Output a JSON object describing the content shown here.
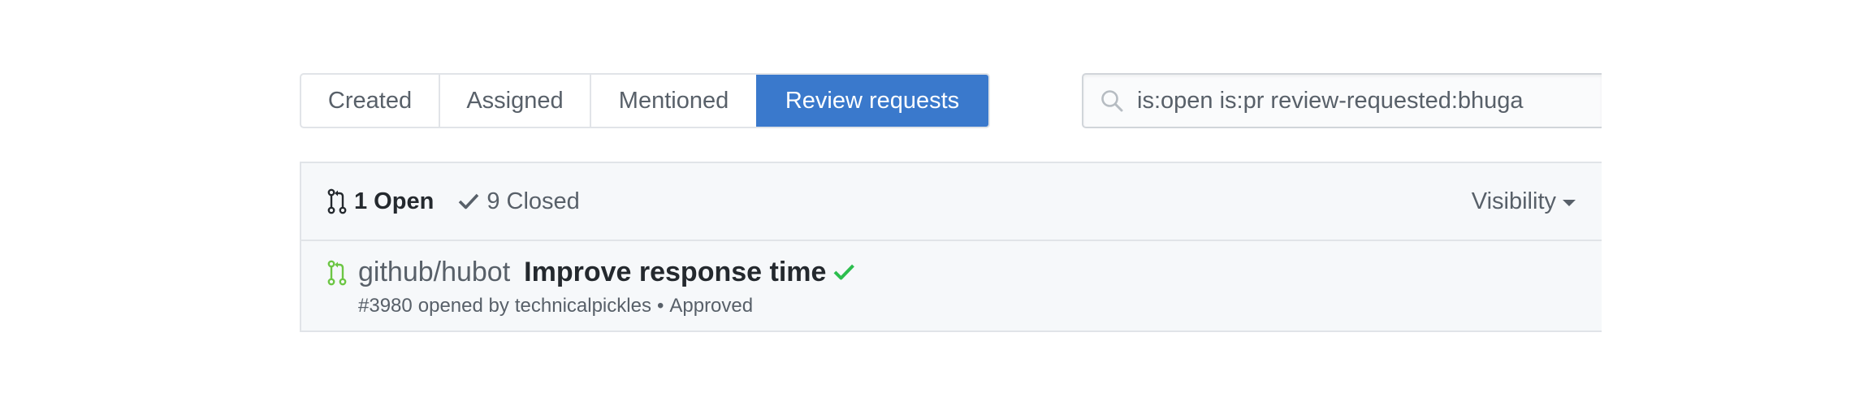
{
  "tabs": [
    {
      "label": "Created",
      "selected": false
    },
    {
      "label": "Assigned",
      "selected": false
    },
    {
      "label": "Mentioned",
      "selected": false
    },
    {
      "label": "Review requests",
      "selected": true
    }
  ],
  "search": {
    "value": "is:open is:pr review-requested:bhuga",
    "icon": "search-icon"
  },
  "states": {
    "open_label": "1 Open",
    "closed_label": "9 Closed"
  },
  "filters": {
    "visibility_label": "Visibility"
  },
  "items": [
    {
      "repo": "github/hubot",
      "title": "Improve response time",
      "status_icon": "check-icon",
      "number": "#3980",
      "opened_by_text": "opened by",
      "author": "technicalpickles",
      "separator": "•",
      "review_status": "Approved"
    }
  ],
  "colors": {
    "selected_tab": "#3a79cc",
    "open_pr_icon": "#6cc644",
    "check": "#2cbe4e"
  }
}
